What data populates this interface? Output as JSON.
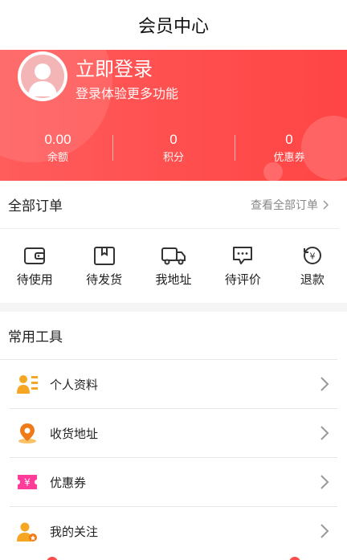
{
  "header": {
    "title": "会员中心"
  },
  "profile": {
    "login_title": "立即登录",
    "login_subtitle": "登录体验更多功能"
  },
  "stats": [
    {
      "value": "0.00",
      "label": "余额"
    },
    {
      "value": "0",
      "label": "积分"
    },
    {
      "value": "0",
      "label": "优惠券"
    }
  ],
  "orders": {
    "title": "全部订单",
    "view_all": "查看全部订单",
    "items": [
      {
        "label": "待使用",
        "icon": "wallet-icon"
      },
      {
        "label": "待发货",
        "icon": "package-icon"
      },
      {
        "label": "我地址",
        "icon": "truck-icon"
      },
      {
        "label": "待评价",
        "icon": "comment-icon"
      },
      {
        "label": "退款",
        "icon": "refund-icon"
      }
    ]
  },
  "tools": {
    "title": "常用工具",
    "items": [
      {
        "label": "个人资料",
        "icon": "profile-card-icon"
      },
      {
        "label": "收货地址",
        "icon": "location-pin-icon"
      },
      {
        "label": "优惠券",
        "icon": "coupon-icon"
      },
      {
        "label": "我的关注",
        "icon": "user-follow-icon"
      }
    ]
  },
  "colors": {
    "accent": "#ff4d4d",
    "orange": "#f5a623",
    "pink": "#ff3c9a"
  }
}
